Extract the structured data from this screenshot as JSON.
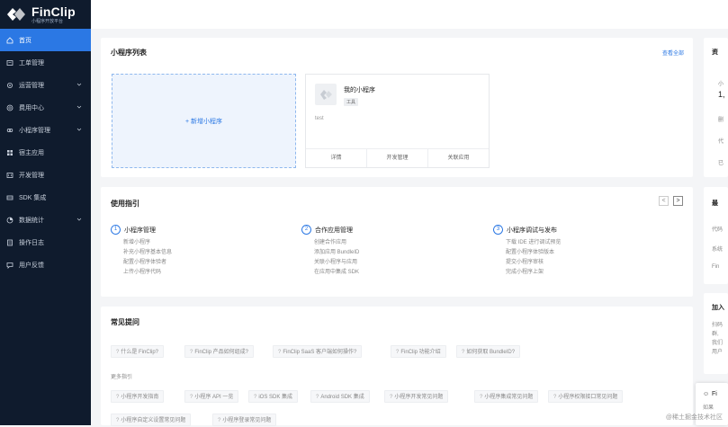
{
  "app": {
    "name": "FinClip",
    "subtitle": "小程序开放平台"
  },
  "colors": {
    "sidebar_bg": "#0f1b2d",
    "accent": "#2b78e4",
    "page_bg": "#f4f5f7"
  },
  "sidebar": {
    "items": [
      {
        "label": "首页",
        "icon": "home-icon",
        "active": true,
        "expandable": false
      },
      {
        "label": "工单管理",
        "icon": "ticket-icon",
        "active": false,
        "expandable": false
      },
      {
        "label": "运营管理",
        "icon": "gear-icon",
        "active": false,
        "expandable": true
      },
      {
        "label": "费用中心",
        "icon": "coin-icon",
        "active": false,
        "expandable": true
      },
      {
        "label": "小程序管理",
        "icon": "miniapp-icon",
        "active": false,
        "expandable": true
      },
      {
        "label": "宿主应用",
        "icon": "grid-icon",
        "active": false,
        "expandable": false
      },
      {
        "label": "开发管理",
        "icon": "code-icon",
        "active": false,
        "expandable": false
      },
      {
        "label": "SDK 集成",
        "icon": "sdk-icon",
        "active": false,
        "expandable": false
      },
      {
        "label": "数据统计",
        "icon": "chart-icon",
        "active": false,
        "expandable": true
      },
      {
        "label": "操作日志",
        "icon": "log-icon",
        "active": false,
        "expandable": false
      },
      {
        "label": "用户反馈",
        "icon": "feedback-icon",
        "active": false,
        "expandable": false
      }
    ]
  },
  "miniapp_list": {
    "title": "小程序列表",
    "view_all": "查看全部",
    "add_label": "+ 新增小程序",
    "app": {
      "name": "我的小程序",
      "tag": "工具",
      "desc": "test",
      "actions": [
        "详情",
        "开发管理",
        "关联应用"
      ]
    }
  },
  "guide": {
    "title": "使用指引",
    "pager_prev": "<",
    "pager_next": ">",
    "columns": [
      {
        "num": "1",
        "title": "小程序管理",
        "items": [
          "新增小程序",
          "补充小程序基本信息",
          "配置小程序体验者",
          "上传小程序代码"
        ]
      },
      {
        "num": "2",
        "title": "合作应用管理",
        "items": [
          "创建合作应用",
          "添加应用 BundleID",
          "关联小程序与应用",
          "在应用中集成 SDK"
        ]
      },
      {
        "num": "3",
        "title": "小程序调试与发布",
        "items": [
          "下载 IDE 进行调试预览",
          "配置小程序体验版本",
          "提交小程序审核",
          "完成小程序上架"
        ]
      }
    ]
  },
  "faq": {
    "title": "常见提问",
    "row1": [
      "什么是 FinClip?",
      "FinClip 产品如何组成?",
      "FinClip SaaS 客户端如何操作?",
      "FinClip 功能介绍",
      "如何获取 BundleID?"
    ],
    "more_label": "更多指引",
    "row2": [
      "小程序开发指南",
      "小程序 API 一览",
      "iOS SDK 集成",
      "Android SDK 集成",
      "小程序开发常见问题",
      "小程序集成常见问题",
      "小程序权限接口常见问题"
    ],
    "row3": [
      "小程序自定义设置常见问题",
      "小程序登录常见问题"
    ]
  },
  "right_panels": {
    "resource": {
      "title": "资",
      "lines": [
        "小",
        "1,",
        "删",
        "代",
        "已"
      ]
    },
    "latest": {
      "title": "最",
      "lines": [
        "代码",
        "系统",
        "Fin"
      ]
    },
    "join": {
      "title": "加入",
      "lines": [
        "扫码",
        "群,",
        "我们",
        "用户"
      ]
    },
    "float_card": "Fi",
    "float_sub": "如果",
    "watermark": "@稀土掘金技术社区"
  }
}
